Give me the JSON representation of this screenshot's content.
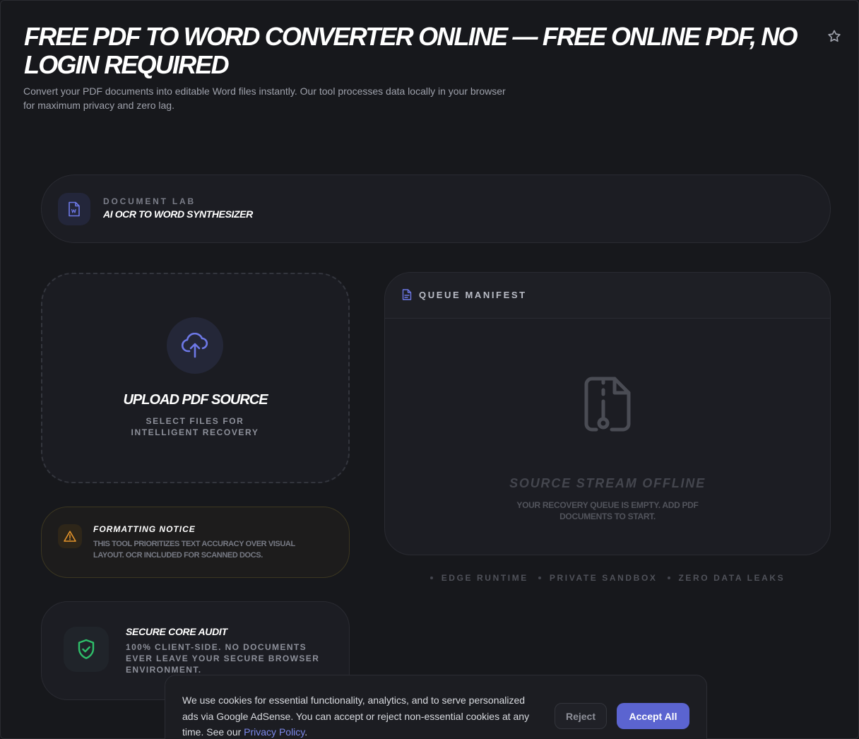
{
  "header": {
    "title": "FREE PDF TO WORD CONVERTER ONLINE — FREE ONLINE PDF, NO LOGIN REQUIRED",
    "subtitle": "Convert your PDF documents into editable Word files instantly. Our tool processes data locally in your browser for maximum privacy and zero lag.",
    "favorite_icon": "star-icon"
  },
  "lab": {
    "icon": "word-file-icon",
    "eyebrow": "DOCUMENT LAB",
    "title": "AI OCR TO WORD SYNTHESIZER"
  },
  "upload": {
    "icon": "cloud-upload-icon",
    "title": "UPLOAD PDF SOURCE",
    "subtitle": "SELECT FILES FOR INTELLIGENT RECOVERY"
  },
  "notice": {
    "icon": "warning-icon",
    "title": "FORMATTING NOTICE",
    "text": "THIS TOOL PRIORITIZES TEXT ACCURACY OVER VISUAL LAYOUT. OCR INCLUDED FOR SCANNED DOCS."
  },
  "audit": {
    "icon": "shield-check-icon",
    "title": "SECURE CORE AUDIT",
    "text": "100% CLIENT-SIDE. NO DOCUMENTS EVER LEAVE YOUR SECURE BROWSER ENVIRONMENT."
  },
  "queue": {
    "icon": "file-list-icon",
    "title": "QUEUE MANIFEST",
    "empty_icon": "file-zip-icon",
    "empty_title": "SOURCE STREAM OFFLINE",
    "empty_text": "YOUR RECOVERY QUEUE IS EMPTY. ADD PDF DOCUMENTS TO START."
  },
  "badges": [
    "EDGE RUNTIME",
    "PRIVATE SANDBOX",
    "ZERO DATA LEAKS"
  ],
  "cookie": {
    "text": "We use cookies for essential functionality, analytics, and to serve personalized ads via Google AdSense. You can accept or reject non-essential cookies at any time. See our ",
    "link_label": "Privacy Policy",
    "text_end": ".",
    "reject_label": "Reject",
    "accept_label": "Accept All"
  },
  "colors": {
    "background": "#17181c",
    "accent": "#5b64d0",
    "warning": "#e3932b",
    "success": "#2fbf6a"
  }
}
